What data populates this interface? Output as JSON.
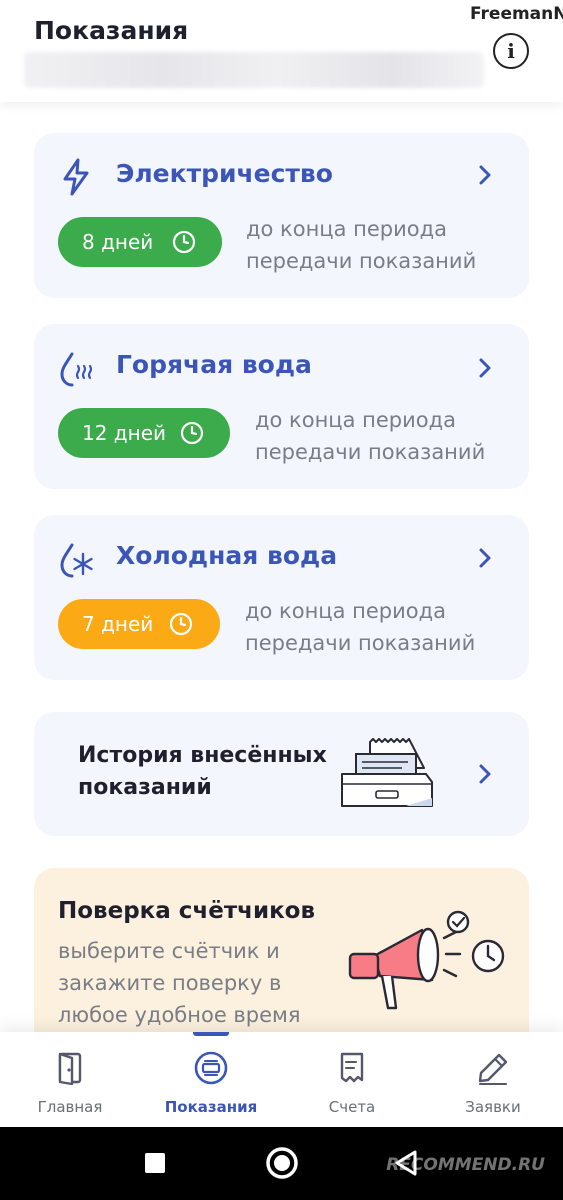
{
  "header": {
    "title": "Показания",
    "username_watermark": "FreemanN"
  },
  "utilities": [
    {
      "title": "Электричество",
      "days": "8 дней",
      "status_color": "#3bab4b",
      "icon": "lightning-icon",
      "period_line1": "до конца периода",
      "period_line2": "передачи показаний"
    },
    {
      "title": "Горячая вода",
      "days": "12 дней",
      "status_color": "#3bab4b",
      "icon": "hot-water-icon",
      "period_line1": "до конца периода",
      "period_line2": "передачи показаний"
    },
    {
      "title": "Холодная вода",
      "days": "7 дней",
      "status_color": "#fbaa15",
      "icon": "cold-water-icon",
      "period_line1": "до конца периода",
      "period_line2": "передачи показаний"
    }
  ],
  "history": {
    "line1": "История внесённых",
    "line2": "показаний",
    "icon": "archive-drawer-icon"
  },
  "promo": {
    "title": "Поверка счётчиков",
    "line1": "выберите счётчик и",
    "line2": "закажите поверку в",
    "line3": "любое удобное время",
    "icon": "megaphone-icon"
  },
  "nav": {
    "items": [
      {
        "label": "Главная",
        "icon": "door-icon",
        "active": false
      },
      {
        "label": "Показания",
        "icon": "meter-icon",
        "active": true
      },
      {
        "label": "Счета",
        "icon": "receipt-icon",
        "active": false
      },
      {
        "label": "Заявки",
        "icon": "pencil-icon",
        "active": false
      }
    ]
  },
  "system_bar": {
    "watermark": "RECOMMEND.RU"
  },
  "colors": {
    "accent": "#3b56b8",
    "card_background": "#f3f6fc",
    "promo_background": "#fcf1de",
    "ok": "#3bab4b",
    "warning": "#fbaa15"
  }
}
